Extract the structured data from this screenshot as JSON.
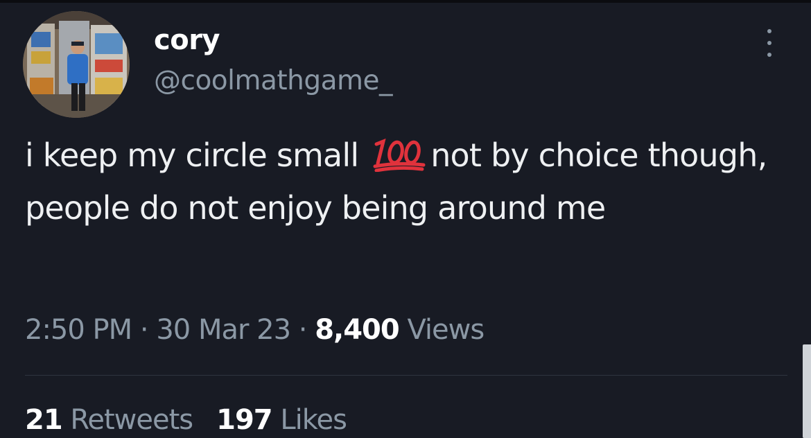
{
  "tweet": {
    "display_name": "cory",
    "handle": "@coolmathgame_",
    "text_part1": "i keep my circle small ",
    "emoji": "hundred-points-emoji",
    "text_part2": "not by choice though, people do not enjoy being around me",
    "time": "2:50 PM",
    "date": "30 Mar 23",
    "views_count": "8,400",
    "views_label": "Views",
    "separator": "·",
    "retweets_count": "21",
    "retweets_label": "Retweets",
    "likes_count": "197",
    "likes_label": "Likes"
  },
  "colors": {
    "background": "#181b24",
    "primary_text": "#ffffff",
    "secondary_text": "#8b98a5",
    "emoji_red": "#e0323c"
  },
  "icons": {
    "more": "more-vertical-icon"
  }
}
